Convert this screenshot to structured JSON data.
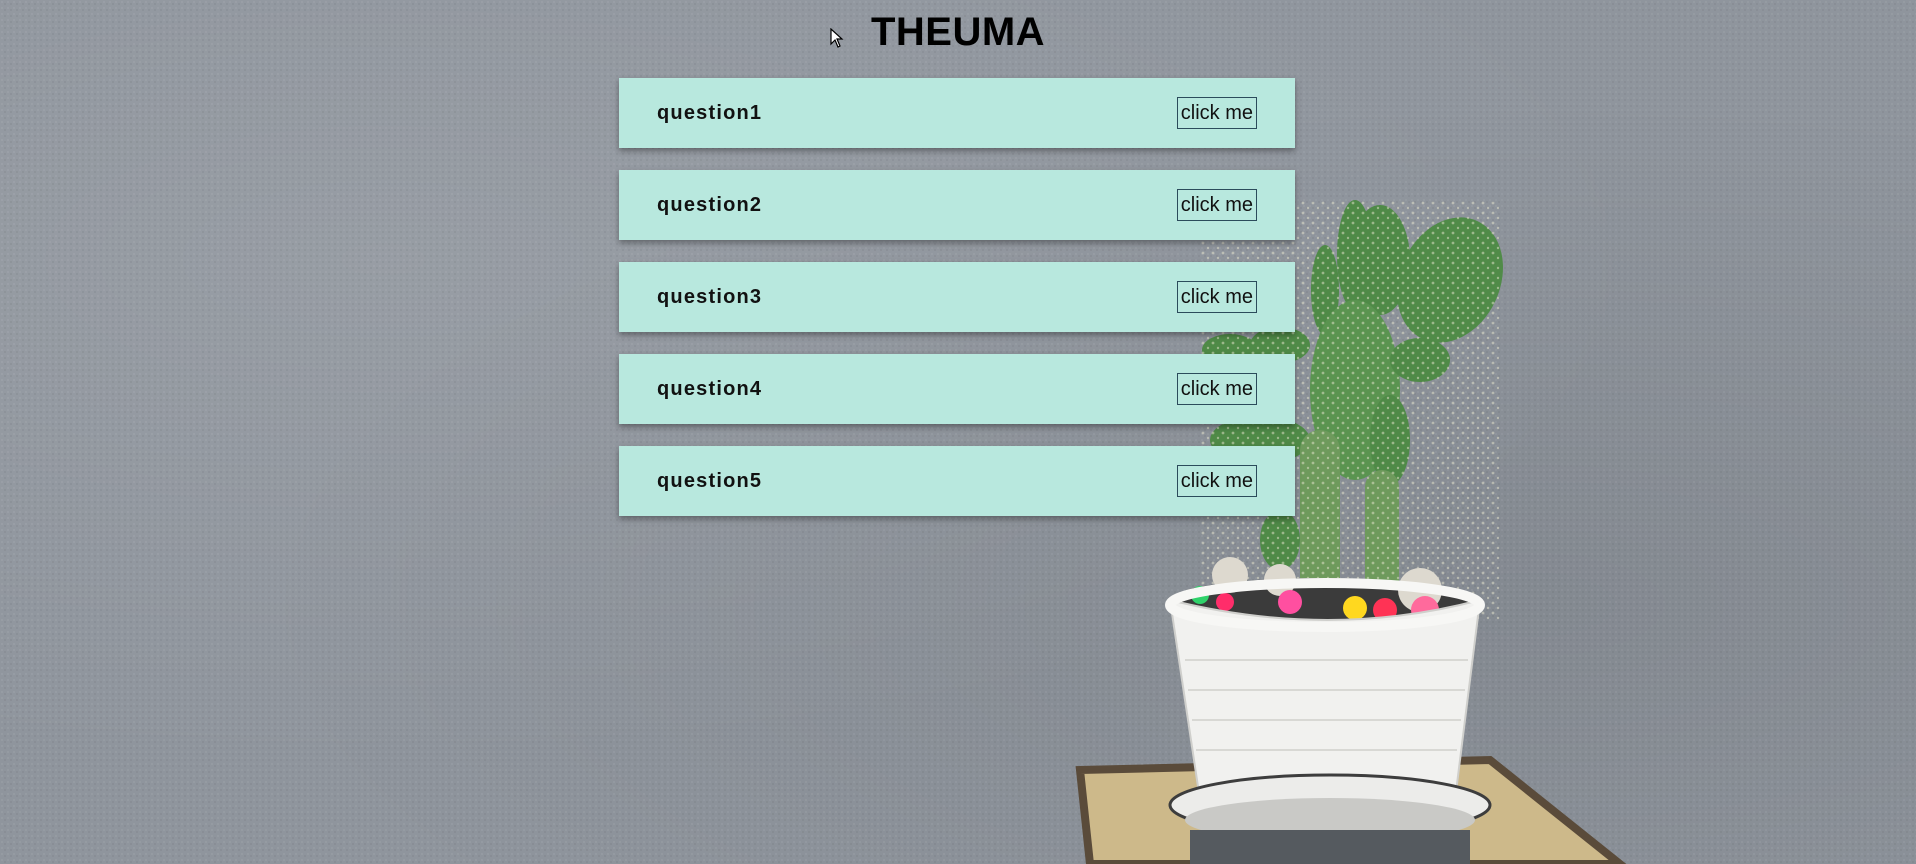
{
  "page": {
    "title": "THEUMA"
  },
  "questions": [
    {
      "label": "question1",
      "button_label": "click me"
    },
    {
      "label": "question2",
      "button_label": "click me"
    },
    {
      "label": "question3",
      "button_label": "click me"
    },
    {
      "label": "question4",
      "button_label": "click me"
    },
    {
      "label": "question5",
      "button_label": "click me"
    }
  ],
  "background": {
    "wall_color": "#8f959d",
    "card_color": "#b8e8de",
    "image_subject": "cactus-in-white-pot"
  }
}
